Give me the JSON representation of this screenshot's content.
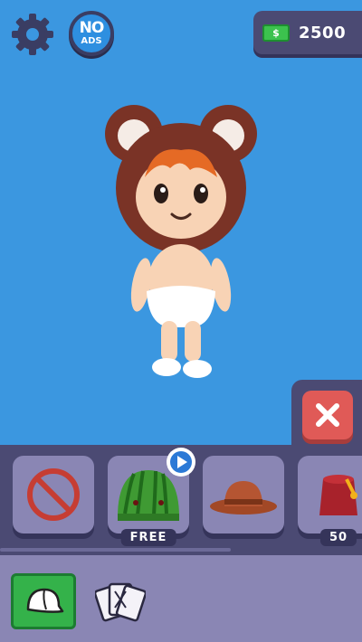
{
  "hud": {
    "coins": "2500",
    "noads_line1": "NO",
    "noads_line2": "ADS"
  },
  "items": [
    {
      "name": "none",
      "price": ""
    },
    {
      "name": "watermelon-hat",
      "price": "FREE"
    },
    {
      "name": "cowboy-hat",
      "price": ""
    },
    {
      "name": "fez-hat",
      "price": "50"
    }
  ],
  "colors": {
    "background": "#3b97e0",
    "panel": "#4b4a73",
    "item_tile": "#8a86b4",
    "close": "#e05a57",
    "selected_category": "#34b24a"
  },
  "categories": [
    {
      "icon": "cap-icon",
      "selected": true
    },
    {
      "icon": "cards-icon",
      "selected": false
    }
  ]
}
